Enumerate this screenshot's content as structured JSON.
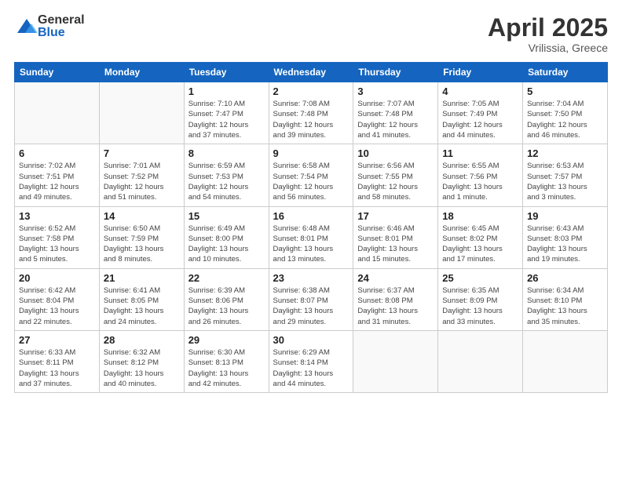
{
  "header": {
    "logo_general": "General",
    "logo_blue": "Blue",
    "month_title": "April 2025",
    "location": "Vrilissia, Greece"
  },
  "weekdays": [
    "Sunday",
    "Monday",
    "Tuesday",
    "Wednesday",
    "Thursday",
    "Friday",
    "Saturday"
  ],
  "weeks": [
    [
      {
        "day": "",
        "info": ""
      },
      {
        "day": "",
        "info": ""
      },
      {
        "day": "1",
        "info": "Sunrise: 7:10 AM\nSunset: 7:47 PM\nDaylight: 12 hours\nand 37 minutes."
      },
      {
        "day": "2",
        "info": "Sunrise: 7:08 AM\nSunset: 7:48 PM\nDaylight: 12 hours\nand 39 minutes."
      },
      {
        "day": "3",
        "info": "Sunrise: 7:07 AM\nSunset: 7:48 PM\nDaylight: 12 hours\nand 41 minutes."
      },
      {
        "day": "4",
        "info": "Sunrise: 7:05 AM\nSunset: 7:49 PM\nDaylight: 12 hours\nand 44 minutes."
      },
      {
        "day": "5",
        "info": "Sunrise: 7:04 AM\nSunset: 7:50 PM\nDaylight: 12 hours\nand 46 minutes."
      }
    ],
    [
      {
        "day": "6",
        "info": "Sunrise: 7:02 AM\nSunset: 7:51 PM\nDaylight: 12 hours\nand 49 minutes."
      },
      {
        "day": "7",
        "info": "Sunrise: 7:01 AM\nSunset: 7:52 PM\nDaylight: 12 hours\nand 51 minutes."
      },
      {
        "day": "8",
        "info": "Sunrise: 6:59 AM\nSunset: 7:53 PM\nDaylight: 12 hours\nand 54 minutes."
      },
      {
        "day": "9",
        "info": "Sunrise: 6:58 AM\nSunset: 7:54 PM\nDaylight: 12 hours\nand 56 minutes."
      },
      {
        "day": "10",
        "info": "Sunrise: 6:56 AM\nSunset: 7:55 PM\nDaylight: 12 hours\nand 58 minutes."
      },
      {
        "day": "11",
        "info": "Sunrise: 6:55 AM\nSunset: 7:56 PM\nDaylight: 13 hours\nand 1 minute."
      },
      {
        "day": "12",
        "info": "Sunrise: 6:53 AM\nSunset: 7:57 PM\nDaylight: 13 hours\nand 3 minutes."
      }
    ],
    [
      {
        "day": "13",
        "info": "Sunrise: 6:52 AM\nSunset: 7:58 PM\nDaylight: 13 hours\nand 5 minutes."
      },
      {
        "day": "14",
        "info": "Sunrise: 6:50 AM\nSunset: 7:59 PM\nDaylight: 13 hours\nand 8 minutes."
      },
      {
        "day": "15",
        "info": "Sunrise: 6:49 AM\nSunset: 8:00 PM\nDaylight: 13 hours\nand 10 minutes."
      },
      {
        "day": "16",
        "info": "Sunrise: 6:48 AM\nSunset: 8:01 PM\nDaylight: 13 hours\nand 13 minutes."
      },
      {
        "day": "17",
        "info": "Sunrise: 6:46 AM\nSunset: 8:01 PM\nDaylight: 13 hours\nand 15 minutes."
      },
      {
        "day": "18",
        "info": "Sunrise: 6:45 AM\nSunset: 8:02 PM\nDaylight: 13 hours\nand 17 minutes."
      },
      {
        "day": "19",
        "info": "Sunrise: 6:43 AM\nSunset: 8:03 PM\nDaylight: 13 hours\nand 19 minutes."
      }
    ],
    [
      {
        "day": "20",
        "info": "Sunrise: 6:42 AM\nSunset: 8:04 PM\nDaylight: 13 hours\nand 22 minutes."
      },
      {
        "day": "21",
        "info": "Sunrise: 6:41 AM\nSunset: 8:05 PM\nDaylight: 13 hours\nand 24 minutes."
      },
      {
        "day": "22",
        "info": "Sunrise: 6:39 AM\nSunset: 8:06 PM\nDaylight: 13 hours\nand 26 minutes."
      },
      {
        "day": "23",
        "info": "Sunrise: 6:38 AM\nSunset: 8:07 PM\nDaylight: 13 hours\nand 29 minutes."
      },
      {
        "day": "24",
        "info": "Sunrise: 6:37 AM\nSunset: 8:08 PM\nDaylight: 13 hours\nand 31 minutes."
      },
      {
        "day": "25",
        "info": "Sunrise: 6:35 AM\nSunset: 8:09 PM\nDaylight: 13 hours\nand 33 minutes."
      },
      {
        "day": "26",
        "info": "Sunrise: 6:34 AM\nSunset: 8:10 PM\nDaylight: 13 hours\nand 35 minutes."
      }
    ],
    [
      {
        "day": "27",
        "info": "Sunrise: 6:33 AM\nSunset: 8:11 PM\nDaylight: 13 hours\nand 37 minutes."
      },
      {
        "day": "28",
        "info": "Sunrise: 6:32 AM\nSunset: 8:12 PM\nDaylight: 13 hours\nand 40 minutes."
      },
      {
        "day": "29",
        "info": "Sunrise: 6:30 AM\nSunset: 8:13 PM\nDaylight: 13 hours\nand 42 minutes."
      },
      {
        "day": "30",
        "info": "Sunrise: 6:29 AM\nSunset: 8:14 PM\nDaylight: 13 hours\nand 44 minutes."
      },
      {
        "day": "",
        "info": ""
      },
      {
        "day": "",
        "info": ""
      },
      {
        "day": "",
        "info": ""
      }
    ]
  ]
}
